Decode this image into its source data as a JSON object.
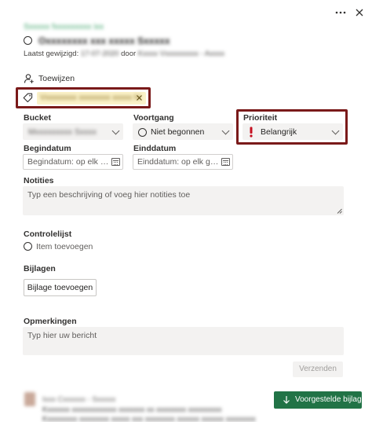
{
  "header": {
    "more_icon": "more-horizontal-icon",
    "close_icon": "close-icon",
    "plan_name": "Sxxxxx fxxxxxxxxx ixx",
    "task_title": "Oxxxxxxxx xxx xxxxx Sxxxxx",
    "last_modified_label": "Laatst gewijzigd:",
    "last_modified_value": "17-07-2020",
    "by_label": "door",
    "modified_by": "Kxxxx Vxxxxxxxxx - Axxxx"
  },
  "assign": {
    "icon": "person-add-icon",
    "label": "Toewijzen"
  },
  "label_tag": {
    "icon": "tag-icon",
    "text": "Vxxxxxxxx xxxxxxxx xxxxx hl",
    "remove_icon": "close-icon"
  },
  "bucket": {
    "label": "Bucket",
    "value": "Mxxxxxxxxx Sxxxx"
  },
  "progress": {
    "label": "Voortgang",
    "value": "Niet begonnen"
  },
  "priority": {
    "label": "Prioriteit",
    "value": "Belangrijk",
    "icon": "exclamation-icon"
  },
  "start_date": {
    "label": "Begindatum",
    "placeholder": "Begindatum: op elk gewenst moment"
  },
  "due_date": {
    "label": "Einddatum",
    "placeholder": "Einddatum: op elk gewenst moment"
  },
  "notes": {
    "label": "Notities",
    "placeholder": "Typ een beschrijving of voeg hier notities toe"
  },
  "checklist": {
    "label": "Controlelijst",
    "add_item": "Item toevoegen"
  },
  "attachments": {
    "label": "Bijlagen",
    "add_button": "Bijlage toevoegen"
  },
  "comments": {
    "label": "Opmerkingen",
    "placeholder": "Typ hier uw bericht",
    "send_button": "Verzenden",
    "suggested_button": "Voorgestelde bijlagen",
    "author": "Ixxx Cxxxxxx - Sxxxxx",
    "line1": "Kxxxxxx xxxxxxxxxxxx xxxxxxx xx xxxxxxxx xxxxxxxxx",
    "line2": "Kxxxxxxxx xxxxxxxx xxxxx xxx xxxxxxxx xxxxxx xxxxxx xxxxxxxx"
  },
  "colors": {
    "accent_green": "#217346",
    "highlight_red": "#7a1a1a",
    "tag_yellow": "#fbf2c9",
    "priority_red": "#c50f1f"
  }
}
